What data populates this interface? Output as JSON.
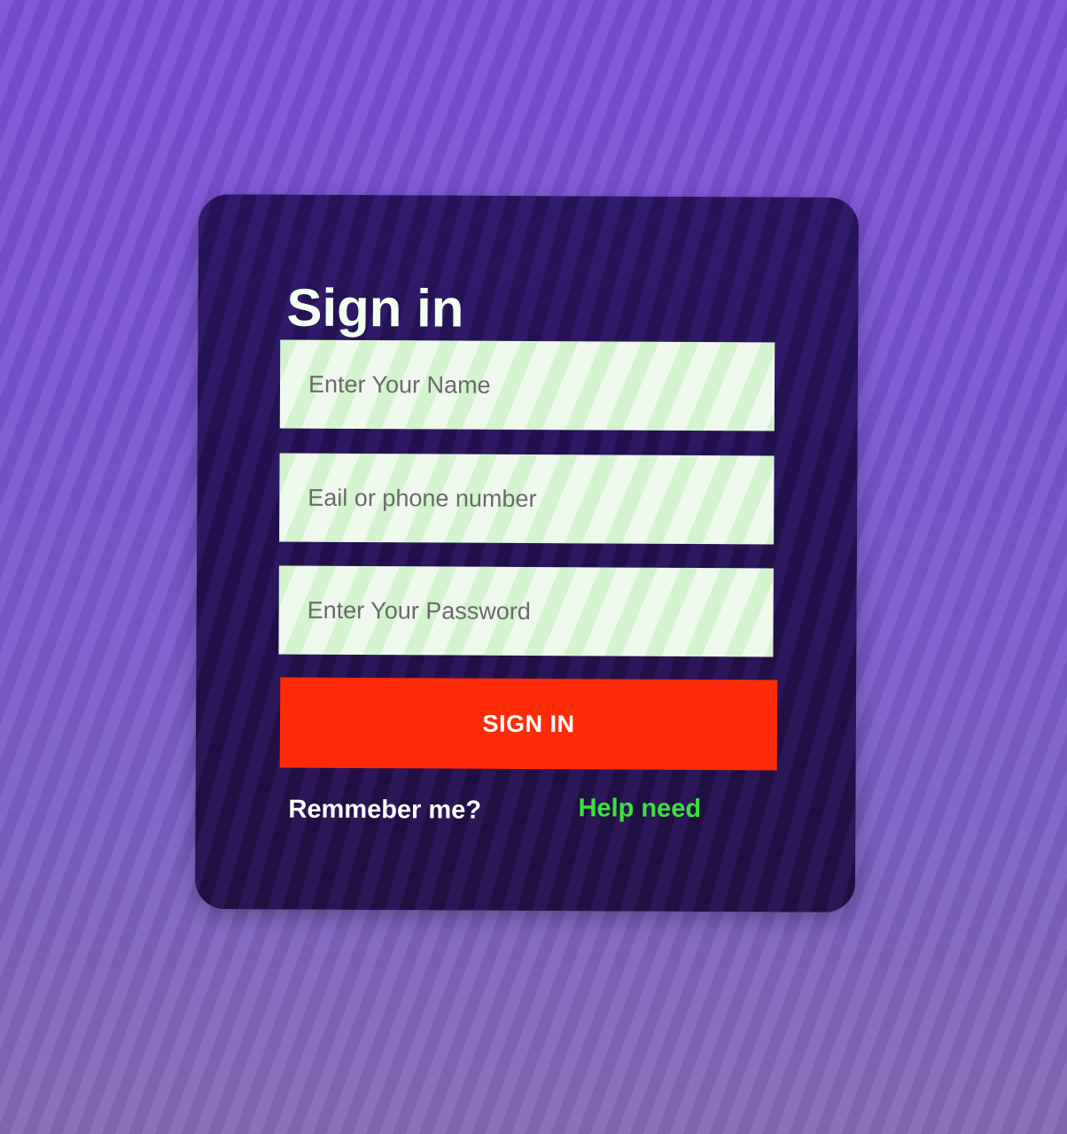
{
  "form": {
    "title": "Sign in",
    "name_placeholder": "Enter Your Name",
    "contact_placeholder": "Eail or phone number",
    "password_placeholder": "Enter Your Password",
    "submit_label": "SIGN IN",
    "remember_label": "Remmeber me?",
    "help_label": "Help need"
  },
  "colors": {
    "background": "#7a55d2",
    "card": "#24104f",
    "title": "#f2fff0",
    "button": "#ff2b08",
    "help_link": "#3be33b"
  }
}
